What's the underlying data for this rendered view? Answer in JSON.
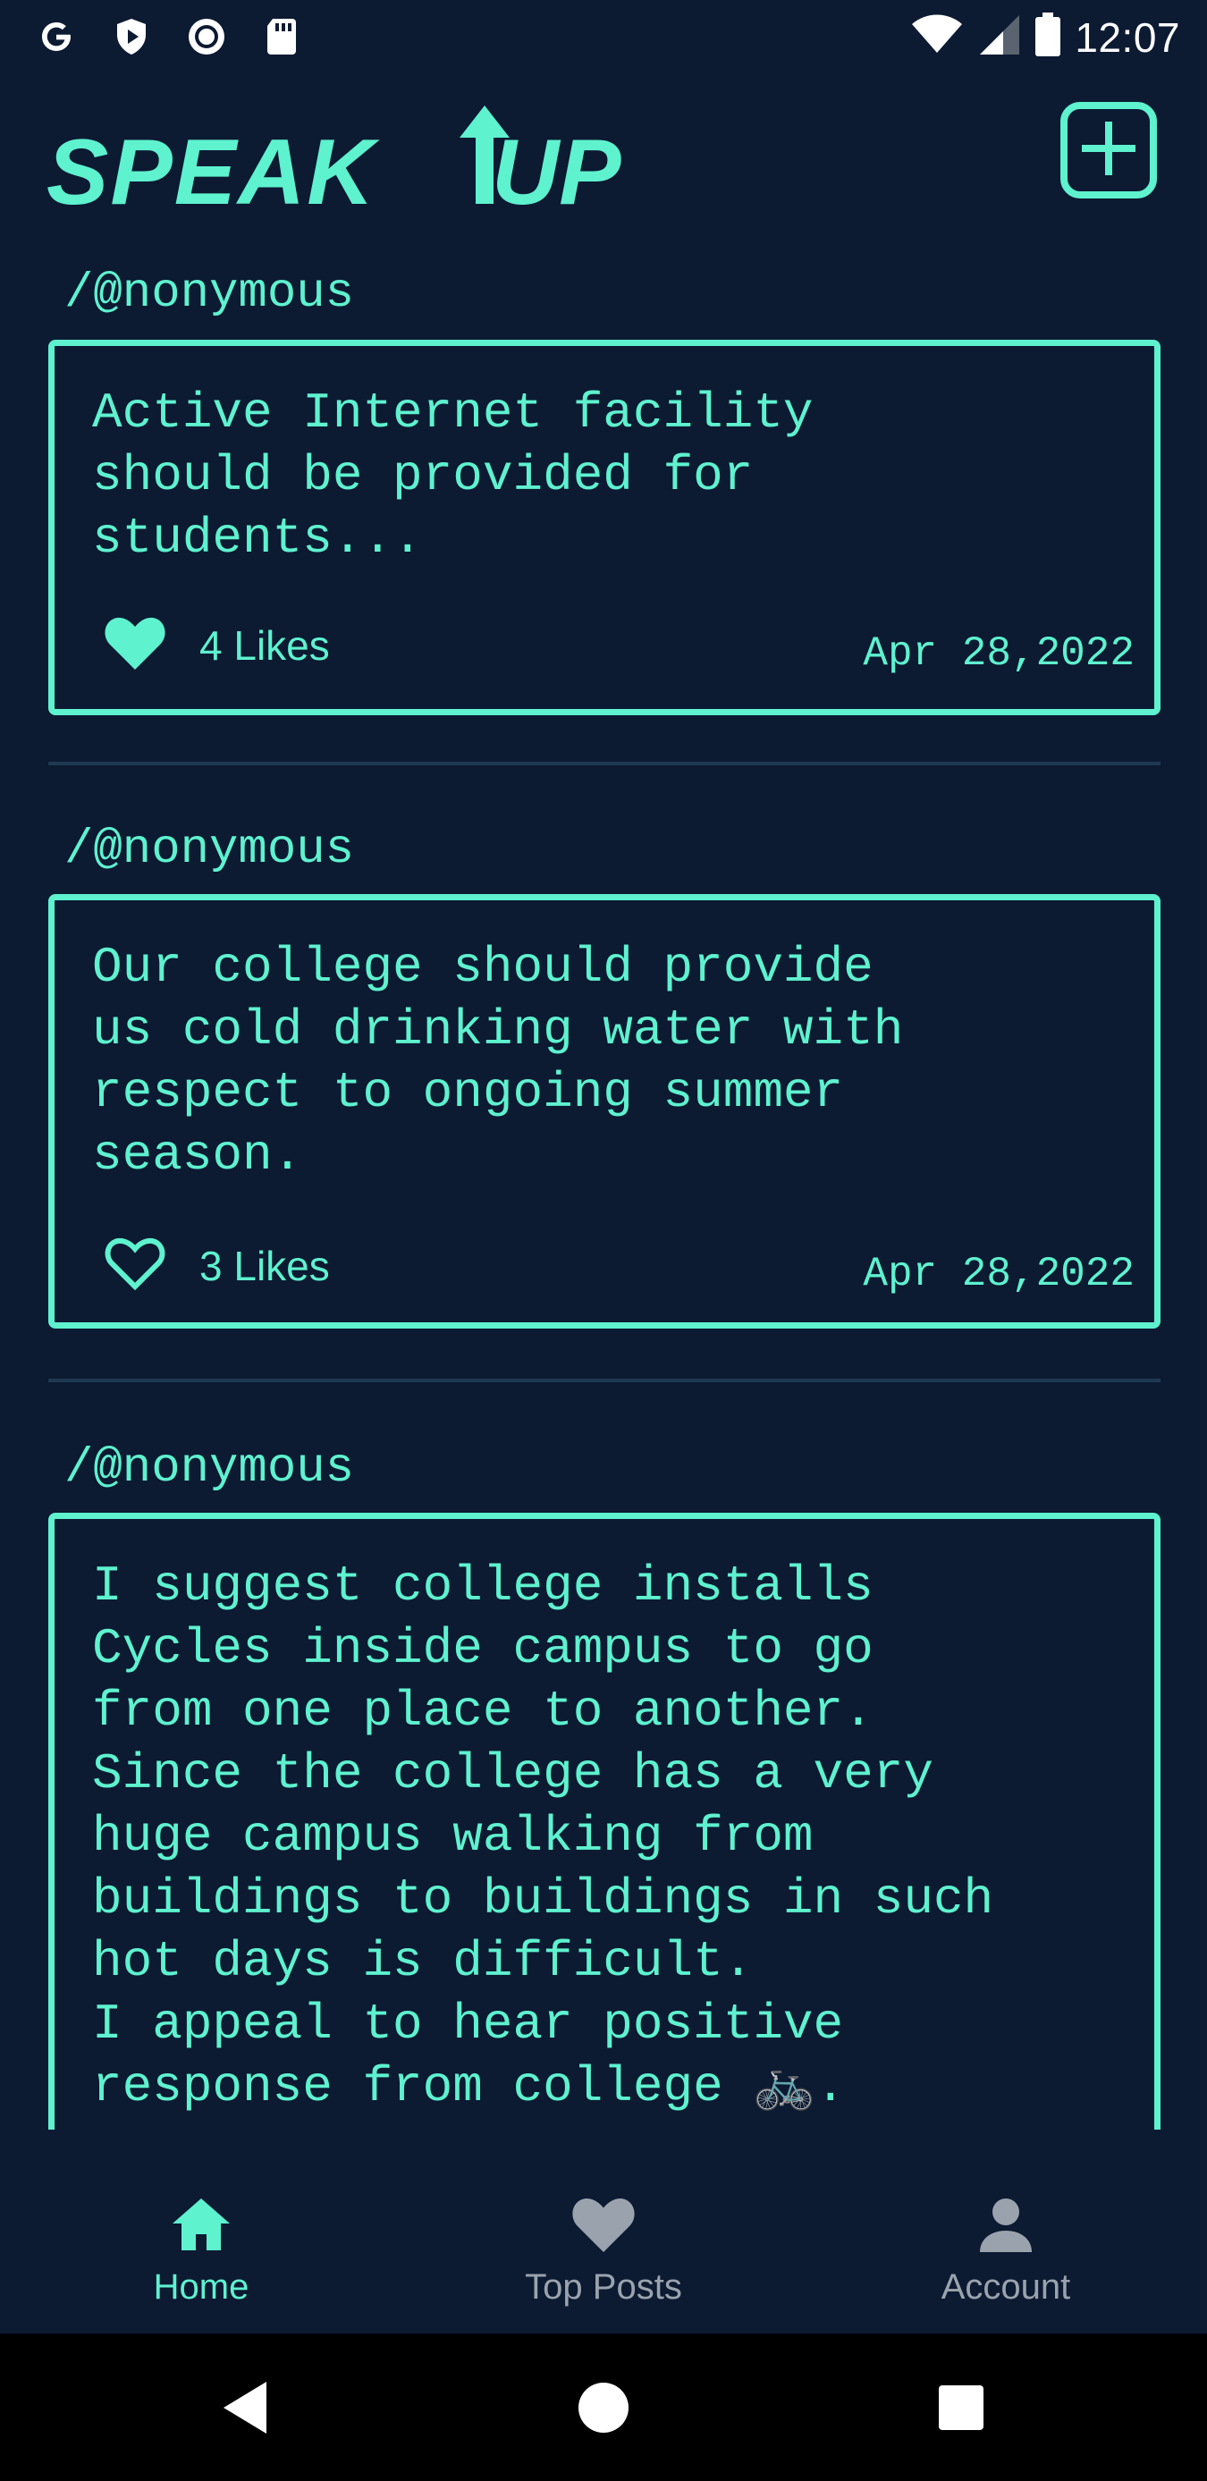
{
  "status_bar": {
    "time": "12:07",
    "left_icons": [
      "google-icon",
      "play-protect-icon",
      "record-icon",
      "sd-card-icon"
    ],
    "right_icons": [
      "wifi-icon",
      "signal-icon",
      "battery-icon"
    ]
  },
  "header": {
    "logo_text": "SPEAK UP",
    "add_button_icon": "plus-square-icon"
  },
  "posts": [
    {
      "author": "/@nonymous",
      "text": "Active Internet facility\nshould be provided for\nstudents...",
      "likes": "4 Likes",
      "liked": true,
      "date": "Apr 28,2022"
    },
    {
      "author": "/@nonymous",
      "text": "Our college should provide\nus cold drinking water with\nrespect to ongoing summer\nseason.",
      "likes": "3 Likes",
      "liked": false,
      "date": "Apr 28,2022"
    },
    {
      "author": "/@nonymous",
      "text": "I suggest college installs\nCycles inside campus to go\nfrom one place to another.\nSince the college has a very\nhuge campus walking from\nbuildings to buildings in such\nhot days is difficult.\nI appeal to hear positive\nresponse from college 🚲.",
      "likes": "",
      "liked": false,
      "date": ""
    }
  ],
  "bottom_nav": [
    {
      "label": "Home",
      "icon": "home-icon",
      "active": true
    },
    {
      "label": "Top Posts",
      "icon": "heart-icon",
      "active": false
    },
    {
      "label": "Account",
      "icon": "person-icon",
      "active": false
    }
  ],
  "colors": {
    "background": "#0c1a32",
    "accent": "#5ef2cf",
    "inactive": "#9aa3ad"
  }
}
